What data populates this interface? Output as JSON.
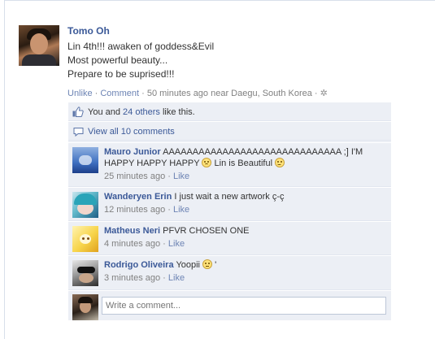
{
  "post": {
    "author": "Tomo Oh",
    "message_lines": [
      "Lin 4th!!! awaken of goddess&Evil",
      "Most powerful beauty...",
      "Prepare to be suprised!!!"
    ],
    "meta": {
      "unlike": "Unlike",
      "comment": "Comment",
      "separator": " · ",
      "time_location": "50 minutes ago near Daegu, South Korea",
      "gear_icon": "gear-icon"
    }
  },
  "likes": {
    "prefix": "You and ",
    "others_link": "24 others",
    "suffix": " like this."
  },
  "view_all": "View all 10 comments",
  "comments": [
    {
      "author": "Mauro Junior",
      "text_parts": [
        "AAAAAAAAAAAAAAAAAAAAAAAAAAAAAA ;] I'M HAPPY HAPPY HAPPY ",
        " Lin is Beautiful "
      ],
      "emoticons": [
        "frown",
        "smile"
      ],
      "time": "25 minutes ago",
      "like": "Like"
    },
    {
      "author": "Wanderyen Erin",
      "text": "I just wait a new artwork ç-ç",
      "time": "12 minutes ago",
      "like": "Like"
    },
    {
      "author": "Matheus Neri",
      "text": "PFVR CHOSEN ONE",
      "time": "4 minutes ago",
      "like": "Like"
    },
    {
      "author": "Rodrigo Oliveira",
      "text_before": "Yoopii ",
      "text_after": " '",
      "emoticon": "flat",
      "time": "3 minutes ago",
      "like": "Like"
    }
  ],
  "write_comment": {
    "placeholder": "Write a comment..."
  },
  "colors": {
    "link": "#3b5998",
    "ufi_background": "#eceff5",
    "meta_grey": "#808080"
  }
}
